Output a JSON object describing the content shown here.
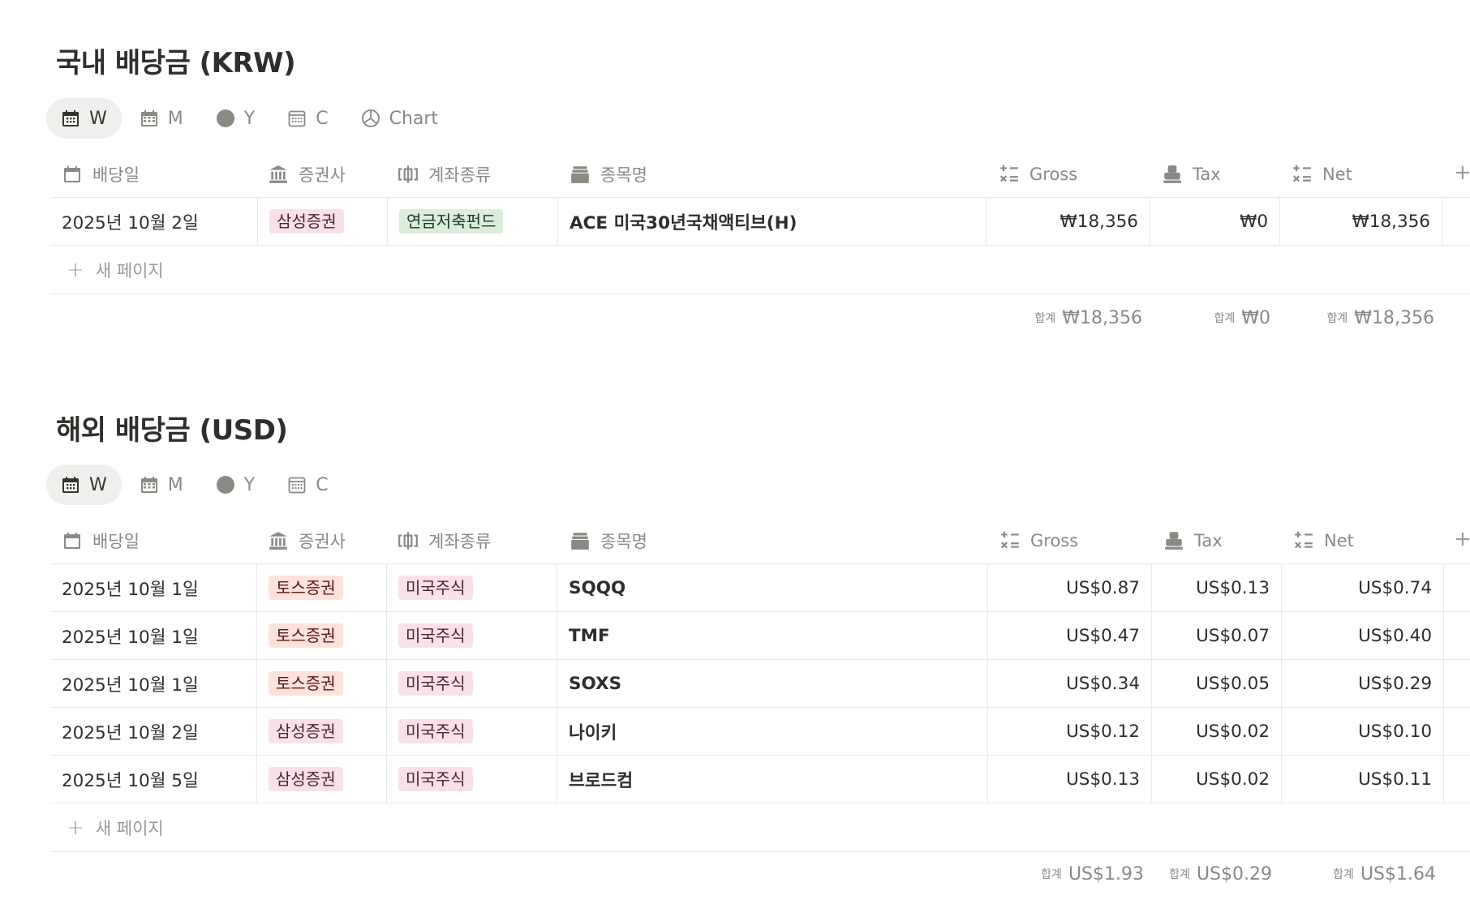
{
  "krw": {
    "title": "국내 배당금 (KRW)",
    "tabs": [
      {
        "icon": "calendar-icon",
        "label": "W",
        "active": true
      },
      {
        "icon": "calendar-grid-icon",
        "label": "M",
        "active": false
      },
      {
        "icon": "circle-icon",
        "label": "Y",
        "active": false
      },
      {
        "icon": "calendar-month-icon",
        "label": "C",
        "active": false
      },
      {
        "icon": "pie-chart-icon",
        "label": "Chart",
        "active": false
      }
    ],
    "headers": {
      "date": "배당일",
      "broker": "증권사",
      "account": "계좌종류",
      "name": "종목명",
      "gross": "Gross",
      "tax": "Tax",
      "net": "Net"
    },
    "rows": [
      {
        "date": "2025년 10월 2일",
        "broker": "삼성증권",
        "account": "연금저축펀드",
        "name": "ACE 미국30년국채액티브(H)",
        "gross": "₩18,356",
        "tax": "₩0",
        "net": "₩18,356"
      }
    ],
    "new_page": "새 페이지",
    "sum_label": "합계",
    "sums": {
      "gross": "₩18,356",
      "tax": "₩0",
      "net": "₩18,356"
    }
  },
  "usd": {
    "title": "해외 배당금 (USD)",
    "tabs": [
      {
        "icon": "calendar-icon",
        "label": "W",
        "active": true
      },
      {
        "icon": "calendar-grid-icon",
        "label": "M",
        "active": false
      },
      {
        "icon": "circle-icon",
        "label": "Y",
        "active": false
      },
      {
        "icon": "calendar-month-icon",
        "label": "C",
        "active": false
      }
    ],
    "headers": {
      "date": "배당일",
      "broker": "증권사",
      "account": "계좌종류",
      "name": "종목명",
      "gross": "Gross",
      "tax": "Tax",
      "net": "Net"
    },
    "rows": [
      {
        "date": "2025년 10월 1일",
        "broker": "토스증권",
        "account": "미국주식",
        "name": "SQQQ",
        "gross": "US$0.87",
        "tax": "US$0.13",
        "net": "US$0.74"
      },
      {
        "date": "2025년 10월 1일",
        "broker": "토스증권",
        "account": "미국주식",
        "name": "TMF",
        "gross": "US$0.47",
        "tax": "US$0.07",
        "net": "US$0.40"
      },
      {
        "date": "2025년 10월 1일",
        "broker": "토스증권",
        "account": "미국주식",
        "name": "SOXS",
        "gross": "US$0.34",
        "tax": "US$0.05",
        "net": "US$0.29"
      },
      {
        "date": "2025년 10월 2일",
        "broker": "삼성증권",
        "account": "미국주식",
        "name": "나이키",
        "gross": "US$0.12",
        "tax": "US$0.02",
        "net": "US$0.10"
      },
      {
        "date": "2025년 10월 5일",
        "broker": "삼성증권",
        "account": "미국주식",
        "name": "브로드컴",
        "gross": "US$0.13",
        "tax": "US$0.02",
        "net": "US$0.11"
      }
    ],
    "new_page": "새 페이지",
    "sum_label": "합계",
    "sums": {
      "gross": "US$1.93",
      "tax": "US$0.29",
      "net": "US$1.64"
    }
  },
  "colors": {
    "samsung_tag_bg": "#f9e2e7",
    "samsung_tag_fg": "#4c2337",
    "toss_tag_bg": "#fde2dd",
    "toss_tag_fg": "#5d1715",
    "pension_tag_bg": "#dbeddb",
    "pension_tag_fg": "#1c3829",
    "us_stock_tag_bg": "#f9e2e7",
    "us_stock_tag_fg": "#4c2337"
  }
}
